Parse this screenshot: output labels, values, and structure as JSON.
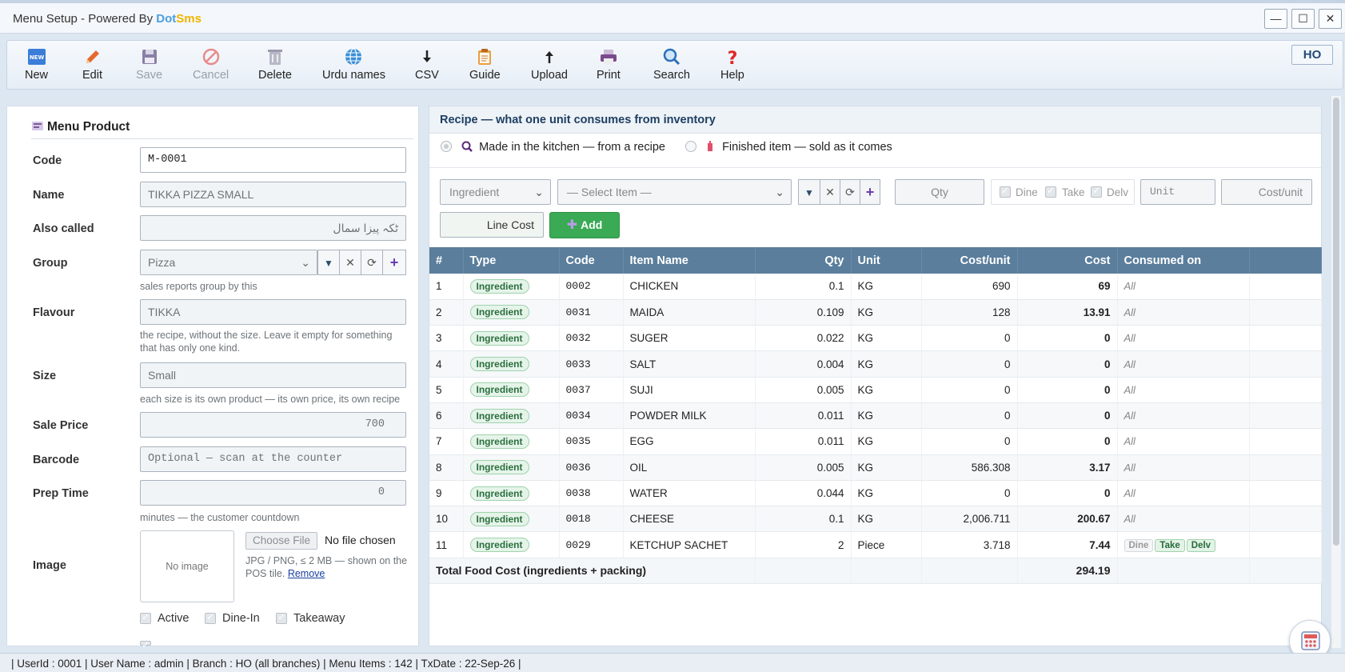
{
  "window": {
    "title_prefix": "Menu Setup - Powered By ",
    "brand_part1": "Dot",
    "brand_part2": "Sms",
    "minimize": "—",
    "maximize": "☐",
    "close": "✕"
  },
  "toolbar": {
    "new": "New",
    "new_badge": "NEW",
    "edit": "Edit",
    "save": "Save",
    "cancel": "Cancel",
    "delete": "Delete",
    "urdu": "Urdu names",
    "csv": "CSV",
    "guide": "Guide",
    "upload": "Upload",
    "print": "Print",
    "search": "Search",
    "help": "Help",
    "ho": "HO"
  },
  "product": {
    "heading": "Menu Product",
    "code_label": "Code",
    "code": "M-0001",
    "name_label": "Name",
    "name": "TIKKA PIZZA SMALL",
    "also_label": "Also called",
    "also": "ٹکہ پیزا سمال",
    "group_label": "Group",
    "group": "Pizza",
    "group_help": "sales reports group by this",
    "flavour_label": "Flavour",
    "flavour": "TIKKA",
    "flavour_help": "the recipe, without the size. Leave it empty for something that has only one kind.",
    "size_label": "Size",
    "size": "Small",
    "size_help": "each size is its own product — its own price, its own recipe",
    "price_label": "Sale Price",
    "price": "700",
    "barcode_label": "Barcode",
    "barcode_placeholder": "Optional — scan at the counter",
    "prep_label": "Prep Time",
    "prep": "0",
    "prep_help": "minutes — the customer countdown",
    "image_label": "Image",
    "no_image": "No image",
    "choose_file": "Choose File",
    "no_file": "No file chosen",
    "image_help": "JPG / PNG, ≤ 2 MB — shown on the POS tile.",
    "remove": "Remove",
    "active": "Active",
    "dinein": "Dine-In",
    "takeaway": "Takeaway"
  },
  "recipe": {
    "heading": "Recipe — what one unit consumes from inventory",
    "mode_kitchen": "Made in the kitchen — from a recipe",
    "mode_finished": "Finished item — sold as it comes",
    "type_select": "Ingredient",
    "item_select": "— Select Item —",
    "qty_placeholder": "Qty",
    "dine": "Dine",
    "take": "Take",
    "delv": "Delv",
    "unit_placeholder": "Unit",
    "costunit_placeholder": "Cost/unit",
    "linecost_placeholder": "Line Cost",
    "add": "Add",
    "columns": [
      "#",
      "Type",
      "Code",
      "Item Name",
      "Qty",
      "Unit",
      "Cost/unit",
      "Cost",
      "Consumed on"
    ],
    "rows": [
      {
        "n": "1",
        "type": "Ingredient",
        "code": "0002",
        "name": "CHICKEN",
        "qty": "0.1",
        "unit": "KG",
        "cpu": "690",
        "cost": "69",
        "on": "All"
      },
      {
        "n": "2",
        "type": "Ingredient",
        "code": "0031",
        "name": "MAIDA",
        "qty": "0.109",
        "unit": "KG",
        "cpu": "128",
        "cost": "13.91",
        "on": "All"
      },
      {
        "n": "3",
        "type": "Ingredient",
        "code": "0032",
        "name": "SUGER",
        "qty": "0.022",
        "unit": "KG",
        "cpu": "0",
        "cost": "0",
        "on": "All"
      },
      {
        "n": "4",
        "type": "Ingredient",
        "code": "0033",
        "name": "SALT",
        "qty": "0.004",
        "unit": "KG",
        "cpu": "0",
        "cost": "0",
        "on": "All"
      },
      {
        "n": "5",
        "type": "Ingredient",
        "code": "0037",
        "name": "SUJI",
        "qty": "0.005",
        "unit": "KG",
        "cpu": "0",
        "cost": "0",
        "on": "All"
      },
      {
        "n": "6",
        "type": "Ingredient",
        "code": "0034",
        "name": "POWDER MILK",
        "qty": "0.011",
        "unit": "KG",
        "cpu": "0",
        "cost": "0",
        "on": "All"
      },
      {
        "n": "7",
        "type": "Ingredient",
        "code": "0035",
        "name": "EGG",
        "qty": "0.011",
        "unit": "KG",
        "cpu": "0",
        "cost": "0",
        "on": "All"
      },
      {
        "n": "8",
        "type": "Ingredient",
        "code": "0036",
        "name": "OIL",
        "qty": "0.005",
        "unit": "KG",
        "cpu": "586.308",
        "cost": "3.17",
        "on": "All"
      },
      {
        "n": "9",
        "type": "Ingredient",
        "code": "0038",
        "name": "WATER",
        "qty": "0.044",
        "unit": "KG",
        "cpu": "0",
        "cost": "0",
        "on": "All"
      },
      {
        "n": "10",
        "type": "Ingredient",
        "code": "0018",
        "name": "CHEESE",
        "qty": "0.1",
        "unit": "KG",
        "cpu": "2,006.711",
        "cost": "200.67",
        "on": "All"
      },
      {
        "n": "11",
        "type": "Ingredient",
        "code": "0029",
        "name": "KETCHUP SACHET",
        "qty": "2",
        "unit": "Piece",
        "cpu": "3.718",
        "cost": "7.44",
        "on_tags": [
          "Dine",
          "Take",
          "Delv"
        ]
      }
    ],
    "total_label": "Total Food Cost (ingredients + packing)",
    "total": "294.19"
  },
  "status": {
    "text": "| UserId : 0001  |  User Name : admin  |  Branch : HO (all branches)  |  Menu Items : 142  |  TxDate : 22-Sep-26 |"
  }
}
